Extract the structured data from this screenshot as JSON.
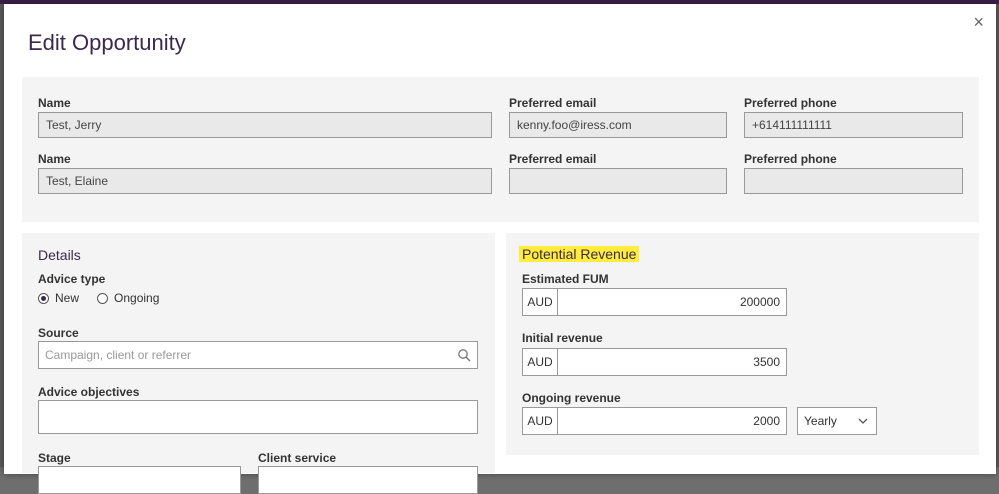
{
  "modal": {
    "title": "Edit Opportunity",
    "close_glyph": "×"
  },
  "contacts": [
    {
      "name_label": "Name",
      "name_value": "Test, Jerry",
      "email_label": "Preferred email",
      "email_value": "kenny.foo@iress.com",
      "phone_label": "Preferred phone",
      "phone_value": "+614111111111"
    },
    {
      "name_label": "Name",
      "name_value": "Test, Elaine",
      "email_label": "Preferred email",
      "email_value": "",
      "phone_label": "Preferred phone",
      "phone_value": ""
    }
  ],
  "details": {
    "title": "Details",
    "advice_type_label": "Advice type",
    "advice_options": [
      "New",
      "Ongoing"
    ],
    "advice_selected": "New",
    "source_label": "Source",
    "source_placeholder": "Campaign, client or referrer",
    "objectives_label": "Advice objectives",
    "stage_label": "Stage",
    "client_service_label": "Client service"
  },
  "revenue": {
    "title": "Potential Revenue",
    "estimated_fum_label": "Estimated FUM",
    "estimated_fum_currency": "AUD",
    "estimated_fum_value": "200000",
    "initial_revenue_label": "Initial revenue",
    "initial_revenue_currency": "AUD",
    "initial_revenue_value": "3500",
    "ongoing_revenue_label": "Ongoing revenue",
    "ongoing_revenue_currency": "AUD",
    "ongoing_revenue_value": "2000",
    "frequency_value": "Yearly"
  },
  "icons": {
    "close": "close-icon",
    "search": "search-icon",
    "chevron": "chevron-down-icon"
  },
  "colors": {
    "accent": "#3b2a4d",
    "highlight": "#ffec3d",
    "panel": "#f4f4f4"
  }
}
